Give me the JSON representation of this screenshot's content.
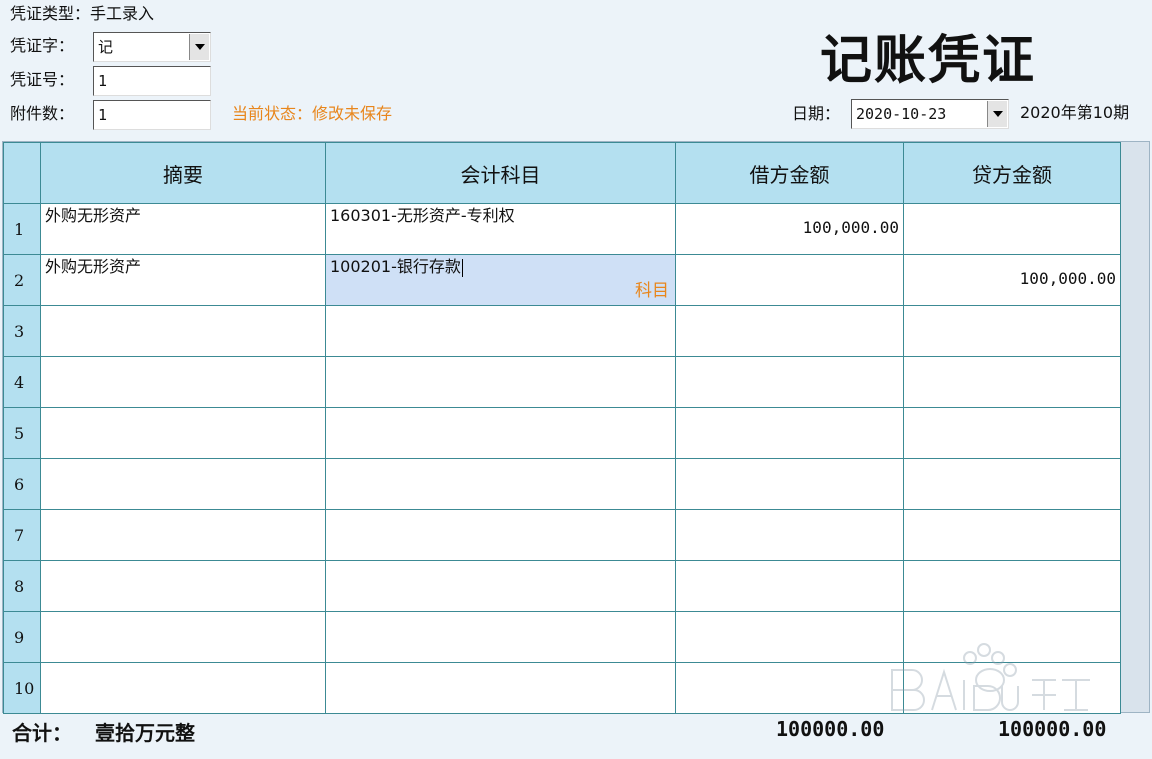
{
  "header": {
    "voucher_type_label": "凭证类型：",
    "voucher_type_value": "手工录入",
    "voucher_word_label": "凭证字：",
    "voucher_word_value": "记",
    "voucher_no_label": "凭证号：",
    "voucher_no_value": "1",
    "attach_label": "附件数：",
    "attach_value": "1",
    "status_text": "当前状态：修改未保存",
    "title": "记账凭证",
    "date_label": "日期：",
    "date_value": "2020-10-23",
    "period_text": "2020年第10期"
  },
  "grid": {
    "columns": [
      "摘要",
      "会计科目",
      "借方金额",
      "贷方金额"
    ],
    "rows": [
      {
        "num": "1",
        "summary": "外购无形资产",
        "account": "160301-无形资产-专利权",
        "debit": "100,000.00",
        "credit": ""
      },
      {
        "num": "2",
        "summary": "外购无形资产",
        "account": "100201-银行存款",
        "debit": "",
        "credit": "100,000.00",
        "hint": "科目"
      },
      {
        "num": "3",
        "summary": "",
        "account": "",
        "debit": "",
        "credit": ""
      },
      {
        "num": "4",
        "summary": "",
        "account": "",
        "debit": "",
        "credit": ""
      },
      {
        "num": "5",
        "summary": "",
        "account": "",
        "debit": "",
        "credit": ""
      },
      {
        "num": "6",
        "summary": "",
        "account": "",
        "debit": "",
        "credit": ""
      },
      {
        "num": "7",
        "summary": "",
        "account": "",
        "debit": "",
        "credit": ""
      },
      {
        "num": "8",
        "summary": "",
        "account": "",
        "debit": "",
        "credit": ""
      },
      {
        "num": "9",
        "summary": "",
        "account": "",
        "debit": "",
        "credit": ""
      },
      {
        "num": "10",
        "summary": "",
        "account": "",
        "debit": "",
        "credit": ""
      }
    ]
  },
  "footer": {
    "total_label": "合计：",
    "total_words": "壹拾万元整",
    "debit_total": "100000.00",
    "credit_total": "100000.00"
  },
  "colors": {
    "accent_orange": "#e8861c",
    "header_blue": "#b4e0f0",
    "grid_line": "#3c8a94",
    "active_cell": "#cfe0f6"
  }
}
